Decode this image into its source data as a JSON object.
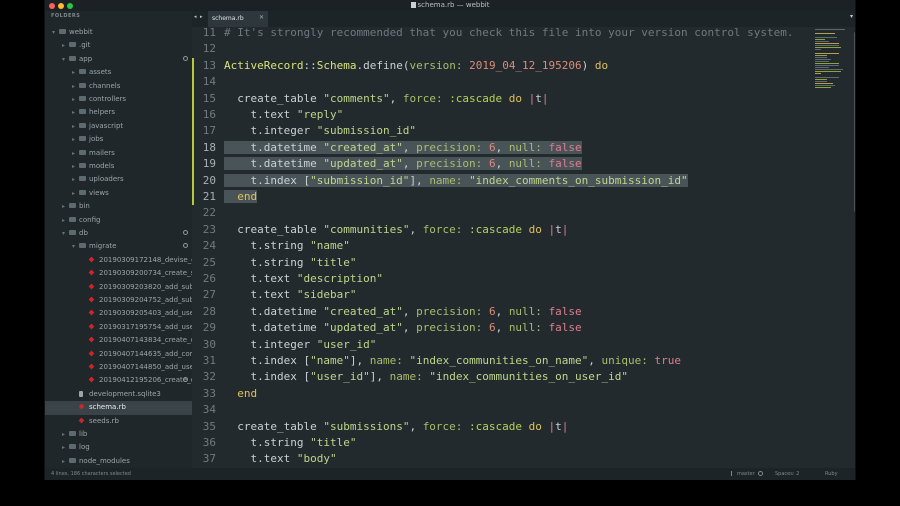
{
  "window": {
    "title": "schema.rb — webbit"
  },
  "sidebar": {
    "header": "FOLDERS",
    "items": [
      {
        "label": "webbit",
        "kind": "folder",
        "open": true,
        "depth": 0
      },
      {
        "label": ".git",
        "kind": "folder",
        "open": false,
        "depth": 1
      },
      {
        "label": "app",
        "kind": "folder",
        "open": true,
        "depth": 1,
        "dot": true
      },
      {
        "label": "assets",
        "kind": "folder",
        "open": false,
        "depth": 2
      },
      {
        "label": "channels",
        "kind": "folder",
        "open": false,
        "depth": 2
      },
      {
        "label": "controllers",
        "kind": "folder",
        "open": false,
        "depth": 2
      },
      {
        "label": "helpers",
        "kind": "folder",
        "open": false,
        "depth": 2
      },
      {
        "label": "javascript",
        "kind": "folder",
        "open": false,
        "depth": 2
      },
      {
        "label": "jobs",
        "kind": "folder",
        "open": false,
        "depth": 2
      },
      {
        "label": "mailers",
        "kind": "folder",
        "open": false,
        "depth": 2
      },
      {
        "label": "models",
        "kind": "folder",
        "open": false,
        "depth": 2
      },
      {
        "label": "uploaders",
        "kind": "folder",
        "open": false,
        "depth": 2
      },
      {
        "label": "views",
        "kind": "folder",
        "open": false,
        "depth": 2
      },
      {
        "label": "bin",
        "kind": "folder",
        "open": false,
        "depth": 1
      },
      {
        "label": "config",
        "kind": "folder",
        "open": false,
        "depth": 1
      },
      {
        "label": "db",
        "kind": "folder",
        "open": true,
        "depth": 1,
        "dot": true
      },
      {
        "label": "migrate",
        "kind": "folder",
        "open": true,
        "depth": 2,
        "dot": true
      },
      {
        "label": "20190309172148_devise_create_",
        "kind": "ruby",
        "depth": 3
      },
      {
        "label": "20190309200734_create_submi",
        "kind": "ruby",
        "depth": 3
      },
      {
        "label": "20190309203820_add_submissi",
        "kind": "ruby",
        "depth": 3
      },
      {
        "label": "20190309204752_add_submissi",
        "kind": "ruby",
        "depth": 3
      },
      {
        "label": "20190309205403_add_user_rela",
        "kind": "ruby",
        "depth": 3
      },
      {
        "label": "20190317195754_add_username",
        "kind": "ruby",
        "depth": 3
      },
      {
        "label": "20190407143834_create_commu",
        "kind": "ruby",
        "depth": 3
      },
      {
        "label": "20190407144635_add_communi",
        "kind": "ruby",
        "depth": 3
      },
      {
        "label": "20190407144850_add_user_ref_",
        "kind": "ruby",
        "depth": 3
      },
      {
        "label": "20190412195206_create_com",
        "kind": "ruby",
        "depth": 3,
        "dot": true
      },
      {
        "label": "development.sqlite3",
        "kind": "file",
        "depth": 2
      },
      {
        "label": "schema.rb",
        "kind": "ruby",
        "depth": 2,
        "selected": true
      },
      {
        "label": "seeds.rb",
        "kind": "ruby",
        "depth": 2
      },
      {
        "label": "lib",
        "kind": "folder",
        "open": false,
        "depth": 1
      },
      {
        "label": "log",
        "kind": "folder",
        "open": false,
        "depth": 1
      },
      {
        "label": "node_modules",
        "kind": "folder",
        "open": false,
        "depth": 1
      }
    ]
  },
  "tabs": [
    {
      "label": "schema.rb",
      "active": true
    }
  ],
  "tab_controls": {
    "prev": "◂",
    "next": "▸",
    "close": "✕",
    "dropdown": "▾"
  },
  "editor": {
    "lines": [
      {
        "n": "11",
        "tokens": [
          [
            "cmt",
            "# It's strongly recommended that you check this file into your version control system."
          ]
        ]
      },
      {
        "n": "12",
        "tokens": []
      },
      {
        "n": "13",
        "mod": true,
        "tokens": [
          [
            "cls",
            "ActiveRecord"
          ],
          [
            "ident",
            "::"
          ],
          [
            "cls",
            "Schema"
          ],
          [
            "ident",
            ".define("
          ],
          [
            "key",
            "version: "
          ],
          [
            "num",
            "2019_04_12_195206"
          ],
          [
            "ident",
            ") "
          ],
          [
            "kw",
            "do"
          ]
        ]
      },
      {
        "n": "14",
        "mod": true,
        "tokens": []
      },
      {
        "n": "15",
        "mod": true,
        "tokens": [
          [
            "ident",
            "  create_table "
          ],
          [
            "str",
            "\"comments\""
          ],
          [
            "ident",
            ", "
          ],
          [
            "key",
            "force: "
          ],
          [
            "sym",
            ":cascade"
          ],
          [
            "ident",
            " "
          ],
          [
            "kw",
            "do"
          ],
          [
            "ident",
            " "
          ],
          [
            "pipe",
            "|"
          ],
          [
            "ident",
            "t"
          ],
          [
            "pipe",
            "|"
          ]
        ]
      },
      {
        "n": "16",
        "mod": true,
        "tokens": [
          [
            "ident",
            "    t.text "
          ],
          [
            "str",
            "\"reply\""
          ]
        ]
      },
      {
        "n": "17",
        "mod": true,
        "tokens": [
          [
            "ident",
            "    t.integer "
          ],
          [
            "str",
            "\"submission_id\""
          ]
        ]
      },
      {
        "n": "18",
        "mod": true,
        "sel": true,
        "tokens": [
          [
            "ident",
            "    t.datetime "
          ],
          [
            "str",
            "\"created_at\""
          ],
          [
            "ident",
            ", "
          ],
          [
            "key",
            "precision: "
          ],
          [
            "num",
            "6"
          ],
          [
            "ident",
            ", "
          ],
          [
            "key",
            "null: "
          ],
          [
            "con",
            "false"
          ]
        ]
      },
      {
        "n": "19",
        "mod": true,
        "sel": true,
        "tokens": [
          [
            "ident",
            "    t.datetime "
          ],
          [
            "str",
            "\"updated_at\""
          ],
          [
            "ident",
            ", "
          ],
          [
            "key",
            "precision: "
          ],
          [
            "num",
            "6"
          ],
          [
            "ident",
            ", "
          ],
          [
            "key",
            "null: "
          ],
          [
            "con",
            "false"
          ]
        ]
      },
      {
        "n": "20",
        "mod": true,
        "sel": true,
        "tokens": [
          [
            "ident",
            "    t.index ["
          ],
          [
            "str",
            "\"submission_id\""
          ],
          [
            "ident",
            "], "
          ],
          [
            "key",
            "name: "
          ],
          [
            "str",
            "\"index_comments_on_submission_id\""
          ]
        ]
      },
      {
        "n": "21",
        "mod": true,
        "sel": true,
        "tokens": [
          [
            "ident",
            "  "
          ],
          [
            "kw",
            "end"
          ]
        ]
      },
      {
        "n": "22",
        "tokens": []
      },
      {
        "n": "23",
        "tokens": [
          [
            "ident",
            "  create_table "
          ],
          [
            "str",
            "\"communities\""
          ],
          [
            "ident",
            ", "
          ],
          [
            "key",
            "force: "
          ],
          [
            "sym",
            ":cascade"
          ],
          [
            "ident",
            " "
          ],
          [
            "kw",
            "do"
          ],
          [
            "ident",
            " "
          ],
          [
            "pipe",
            "|"
          ],
          [
            "ident",
            "t"
          ],
          [
            "pipe",
            "|"
          ]
        ]
      },
      {
        "n": "24",
        "tokens": [
          [
            "ident",
            "    t.string "
          ],
          [
            "str",
            "\"name\""
          ]
        ]
      },
      {
        "n": "25",
        "tokens": [
          [
            "ident",
            "    t.string "
          ],
          [
            "str",
            "\"title\""
          ]
        ]
      },
      {
        "n": "26",
        "tokens": [
          [
            "ident",
            "    t.text "
          ],
          [
            "str",
            "\"description\""
          ]
        ]
      },
      {
        "n": "27",
        "tokens": [
          [
            "ident",
            "    t.text "
          ],
          [
            "str",
            "\"sidebar\""
          ]
        ]
      },
      {
        "n": "28",
        "tokens": [
          [
            "ident",
            "    t.datetime "
          ],
          [
            "str",
            "\"created_at\""
          ],
          [
            "ident",
            ", "
          ],
          [
            "key",
            "precision: "
          ],
          [
            "num",
            "6"
          ],
          [
            "ident",
            ", "
          ],
          [
            "key",
            "null: "
          ],
          [
            "con",
            "false"
          ]
        ]
      },
      {
        "n": "29",
        "tokens": [
          [
            "ident",
            "    t.datetime "
          ],
          [
            "str",
            "\"updated_at\""
          ],
          [
            "ident",
            ", "
          ],
          [
            "key",
            "precision: "
          ],
          [
            "num",
            "6"
          ],
          [
            "ident",
            ", "
          ],
          [
            "key",
            "null: "
          ],
          [
            "con",
            "false"
          ]
        ]
      },
      {
        "n": "30",
        "tokens": [
          [
            "ident",
            "    t.integer "
          ],
          [
            "str",
            "\"user_id\""
          ]
        ]
      },
      {
        "n": "31",
        "tokens": [
          [
            "ident",
            "    t.index ["
          ],
          [
            "str",
            "\"name\""
          ],
          [
            "ident",
            "], "
          ],
          [
            "key",
            "name: "
          ],
          [
            "str",
            "\"index_communities_on_name\""
          ],
          [
            "ident",
            ", "
          ],
          [
            "key",
            "unique: "
          ],
          [
            "con",
            "true"
          ]
        ]
      },
      {
        "n": "32",
        "tokens": [
          [
            "ident",
            "    t.index ["
          ],
          [
            "str",
            "\"user_id\""
          ],
          [
            "ident",
            "], "
          ],
          [
            "key",
            "name: "
          ],
          [
            "str",
            "\"index_communities_on_user_id\""
          ]
        ]
      },
      {
        "n": "33",
        "tokens": [
          [
            "ident",
            "  "
          ],
          [
            "kw",
            "end"
          ]
        ]
      },
      {
        "n": "34",
        "tokens": []
      },
      {
        "n": "35",
        "tokens": [
          [
            "ident",
            "  create_table "
          ],
          [
            "str",
            "\"submissions\""
          ],
          [
            "ident",
            ", "
          ],
          [
            "key",
            "force: "
          ],
          [
            "sym",
            ":cascade"
          ],
          [
            "ident",
            " "
          ],
          [
            "kw",
            "do"
          ],
          [
            "ident",
            " "
          ],
          [
            "pipe",
            "|"
          ],
          [
            "ident",
            "t"
          ],
          [
            "pipe",
            "|"
          ]
        ]
      },
      {
        "n": "36",
        "tokens": [
          [
            "ident",
            "    t.string "
          ],
          [
            "str",
            "\"title\""
          ]
        ]
      },
      {
        "n": "37",
        "tokens": [
          [
            "ident",
            "    t.text "
          ],
          [
            "str",
            "\"body\""
          ]
        ]
      }
    ]
  },
  "status": {
    "left": "4 lines, 186 characters selected",
    "branch": "master",
    "spaces": "Spaces: 2",
    "syntax": "Ruby"
  },
  "colors": {
    "window_bg": "#232a2d",
    "sidebar_bg": "#20272a",
    "selection": "#495459",
    "gutter_modified": "#b8c93a"
  }
}
